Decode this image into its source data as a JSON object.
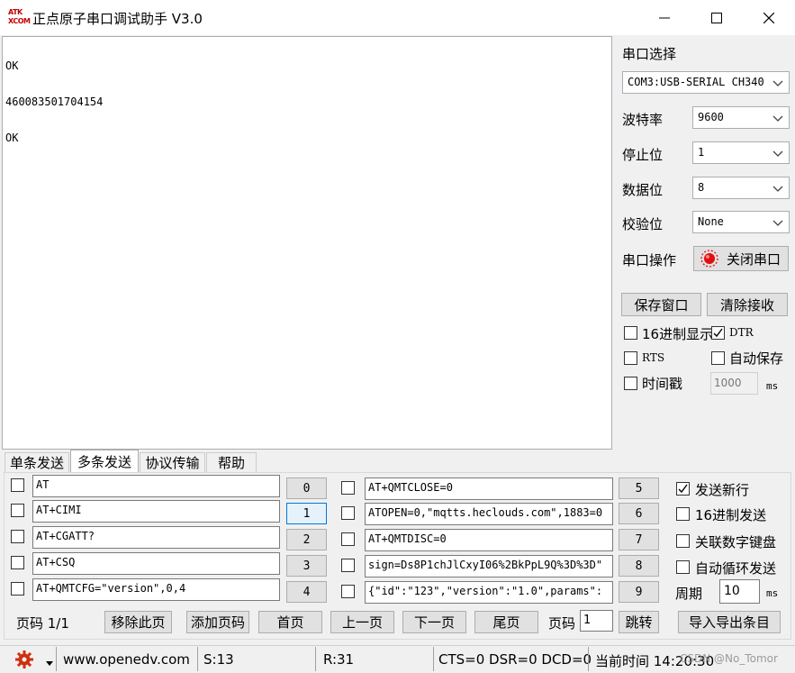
{
  "titlebar": {
    "icon_text_top": "ATK",
    "icon_text_bottom": "XCOM",
    "title": "正点原子串口调试助手 V3.0"
  },
  "receive": {
    "lines": [
      "OK",
      "460083501704154",
      "OK"
    ]
  },
  "settings": {
    "port_label": "串口选择",
    "port_value": "COM3:USB-SERIAL CH340",
    "baud_label": "波特率",
    "baud_value": "9600",
    "stop_label": "停止位",
    "stop_value": "1",
    "data_label": "数据位",
    "data_value": "8",
    "parity_label": "校验位",
    "parity_value": "None",
    "op_label": "串口操作",
    "close_port_button": "关闭串口",
    "save_window_button": "保存窗口",
    "clear_receive_button": "清除接收",
    "hex_display_label": "16进制显示",
    "dtr_label": "DTR",
    "rts_label": "RTS",
    "auto_save_label": "自动保存",
    "timestamp_label": "时间戳",
    "timestamp_value": "1000",
    "timestamp_unit": "ms",
    "dtr_checked": true
  },
  "tabs": [
    "单条发送",
    "多条发送",
    "协议传输",
    "帮助"
  ],
  "commands_left": [
    {
      "text": "AT",
      "num": "0"
    },
    {
      "text": "AT+CIMI",
      "num": "1"
    },
    {
      "text": "AT+CGATT?",
      "num": "2"
    },
    {
      "text": "AT+CSQ",
      "num": "3"
    },
    {
      "text": "AT+QMTCFG=\"version\",0,4",
      "num": "4"
    }
  ],
  "commands_right": [
    {
      "text": "AT+QMTCLOSE=0",
      "num": "5"
    },
    {
      "text": "ATOPEN=0,\"mqtts.heclouds.com\",1883=0",
      "num": "6"
    },
    {
      "text": "AT+QMTDISC=0",
      "num": "7"
    },
    {
      "text": "sign=Ds8P1chJlCxyI06%2BkPpL9Q%3D%3D\"",
      "num": "8"
    },
    {
      "text": "{\"id\":\"123\",\"version\":\"1.0\",params\":",
      "num": "9"
    }
  ],
  "send_options": {
    "send_newline_label": "发送新行",
    "send_newline_checked": true,
    "hex_send_label": "16进制发送",
    "numpad_label": "关联数字键盘",
    "auto_loop_label": "自动循环发送",
    "period_label": "周期",
    "period_value": "10",
    "period_unit": "ms"
  },
  "pager": {
    "page_label": "页码 1/1",
    "remove_page": "移除此页",
    "add_page": "添加页码",
    "first_page": "首页",
    "prev_page": "上一页",
    "next_page": "下一页",
    "last_page": "尾页",
    "goto_label": "页码",
    "goto_value": "1",
    "jump": "跳转",
    "import_export": "导入导出条目"
  },
  "status": {
    "website": "www.openedv.com",
    "sent": "S:13",
    "received": "R:31",
    "lines": "CTS=0 DSR=0 DCD=0",
    "time": "当前时间 14:20:30",
    "watermark": "CSDN @No_Tomor"
  },
  "colors": {
    "led_red": "#e01010",
    "gear_red": "#d03010"
  }
}
